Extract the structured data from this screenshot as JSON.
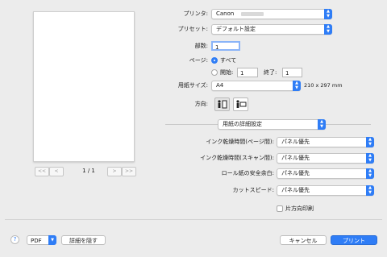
{
  "preview": {
    "page_indicator": "1 / 1",
    "nav": {
      "first": "<<",
      "prev": "<",
      "next": ">",
      "last": ">>"
    }
  },
  "printer": {
    "label": "プリンタ:",
    "value": "Canon"
  },
  "preset": {
    "label": "プリセット:",
    "value": "デフォルト設定"
  },
  "copies": {
    "label": "部数:",
    "value": "1"
  },
  "pages": {
    "label": "ページ:",
    "all_label": "すべて",
    "from_label": "開始:",
    "from_value": "1",
    "to_label": "終了:",
    "to_value": "1"
  },
  "paper_size": {
    "label": "用紙サイズ:",
    "value": "A4",
    "dimensions": "210 x 297 mm"
  },
  "orientation": {
    "label": "方向:"
  },
  "section_popup": {
    "value": "用紙の詳細設定"
  },
  "details": [
    {
      "label": "インク乾燥時間(ページ間):",
      "value": "パネル優先"
    },
    {
      "label": "インク乾燥時間(スキャン間):",
      "value": "パネル優先"
    },
    {
      "label": "ロール紙の安全余白:",
      "value": "パネル優先"
    },
    {
      "label": "カットスピード:",
      "value": "パネル優先"
    }
  ],
  "one_way": {
    "label": "片方向印刷",
    "checked": false
  },
  "footer": {
    "help": "?",
    "pdf": "PDF",
    "hide_details": "詳細を隠す",
    "cancel": "キャンセル",
    "print": "プリント"
  },
  "colors": {
    "accent": "#2f7df6",
    "background": "#ececec"
  }
}
